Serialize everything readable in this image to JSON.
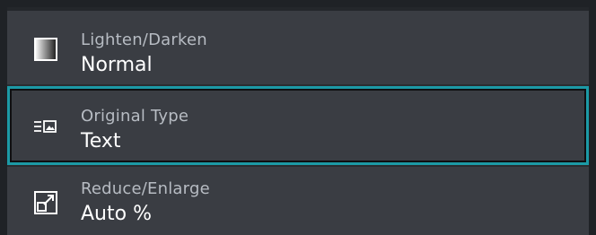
{
  "settings": [
    {
      "label": "Lighten/Darken",
      "value": "Normal",
      "icon": "lighten-darken-icon",
      "selected": false
    },
    {
      "label": "Original Type",
      "value": "Text",
      "icon": "original-type-icon",
      "selected": true
    },
    {
      "label": "Reduce/Enlarge",
      "value": "Auto %",
      "icon": "reduce-enlarge-icon",
      "selected": false
    }
  ],
  "colors": {
    "background": "#1f2226",
    "panel": "#3a3d43",
    "selection_border": "#1c9aa6",
    "label_text": "#b7bcc3",
    "value_text": "#ffffff"
  }
}
